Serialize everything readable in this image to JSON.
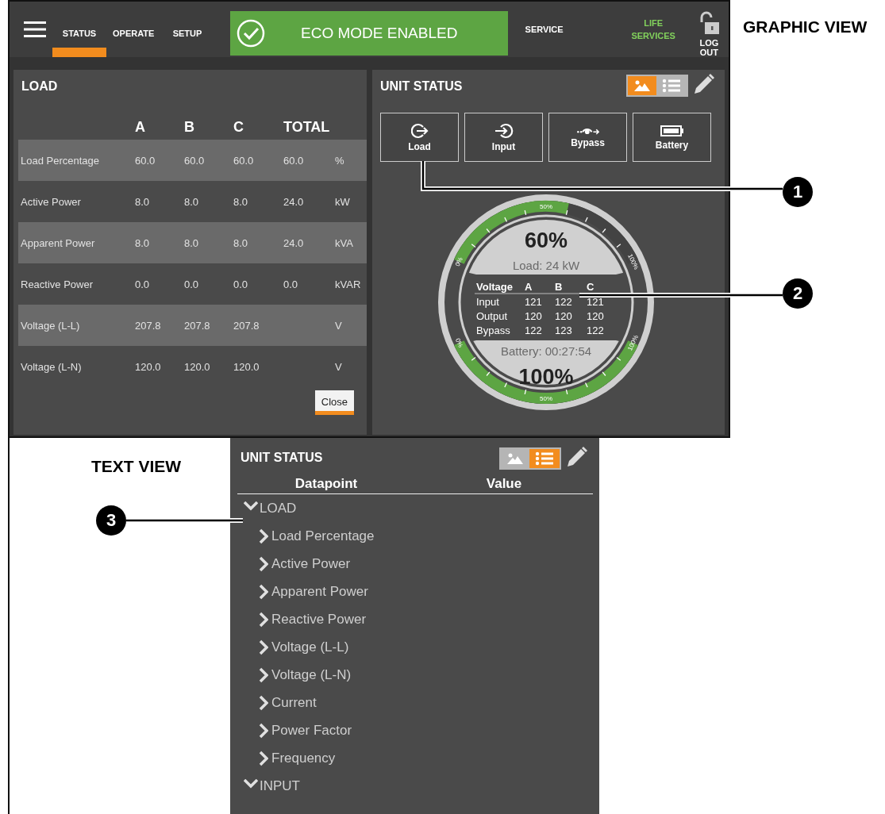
{
  "graphic_view": {
    "caption": "GRAPHIC VIEW",
    "nav": {
      "tabs": [
        {
          "label": "STATUS",
          "selected": true
        },
        {
          "label": "OPERATE",
          "selected": false
        },
        {
          "label": "SETUP",
          "selected": false
        }
      ],
      "banner": "ECO MODE ENABLED",
      "service": "SERVICE",
      "life_services": "LIFE SERVICES",
      "logout": "LOG OUT"
    },
    "load_panel": {
      "title": "LOAD",
      "columns": [
        "A",
        "B",
        "C",
        "TOTAL"
      ],
      "rows": [
        {
          "label": "Load Percentage",
          "values": [
            "60.0",
            "60.0",
            "60.0",
            "60.0"
          ],
          "unit": "%"
        },
        {
          "label": "Active Power",
          "values": [
            "8.0",
            "8.0",
            "8.0",
            "24.0"
          ],
          "unit": "kW"
        },
        {
          "label": "Apparent Power",
          "values": [
            "8.0",
            "8.0",
            "8.0",
            "24.0"
          ],
          "unit": "kVA"
        },
        {
          "label": "Reactive Power",
          "values": [
            "0.0",
            "0.0",
            "0.0",
            "0.0"
          ],
          "unit": "kVAR"
        },
        {
          "label": "Voltage (L-L)",
          "values": [
            "207.8",
            "207.8",
            "207.8"
          ],
          "unit": "V"
        },
        {
          "label": "Voltage (L-N)",
          "values": [
            "120.0",
            "120.0",
            "120.0"
          ],
          "unit": "V"
        }
      ],
      "close_button": "Close"
    },
    "unit_status": {
      "title": "UNIT STATUS",
      "view_toggle": [
        {
          "kind": "graphic",
          "selected": true
        },
        {
          "kind": "text",
          "selected": false
        }
      ],
      "buttons": [
        {
          "kind": "load",
          "label": "Load"
        },
        {
          "kind": "input",
          "label": "Input"
        },
        {
          "kind": "bypass",
          "label": "Bypass"
        },
        {
          "kind": "battery",
          "label": "Battery"
        }
      ],
      "gauge": {
        "load": {
          "level": 0.6,
          "value": "60%",
          "caption": "Load: 24 kW",
          "scale_labels": [
            "0%",
            "50%",
            "100%"
          ]
        },
        "battery": {
          "level": 1,
          "value": "100%",
          "caption": "Battery: 00:27:54",
          "scale_labels": [
            "0%",
            "50%",
            "100%"
          ]
        },
        "voltage": {
          "columns": [
            "Voltage",
            "A",
            "B",
            "C"
          ],
          "rows": [
            {
              "label": "Input",
              "values": [
                "121",
                "122",
                "121"
              ]
            },
            {
              "label": "Output",
              "values": [
                "120",
                "120",
                "120"
              ]
            },
            {
              "label": "Bypass",
              "values": [
                "122",
                "123",
                "122"
              ]
            }
          ]
        }
      }
    }
  },
  "text_view": {
    "caption": "TEXT VIEW",
    "unit_status": {
      "title": "UNIT STATUS",
      "view_toggle": [
        {
          "kind": "graphic",
          "selected": false
        },
        {
          "kind": "text",
          "selected": true
        }
      ],
      "columns": [
        "Datapoint",
        "Value"
      ],
      "tree": [
        {
          "label": "LOAD",
          "expanded": true,
          "children": [
            {
              "label": "Load Percentage",
              "expanded": false
            },
            {
              "label": "Active Power",
              "expanded": false
            },
            {
              "label": "Apparent Power",
              "expanded": false
            },
            {
              "label": "Reactive Power",
              "expanded": false
            },
            {
              "label": "Voltage (L-L)",
              "expanded": false
            },
            {
              "label": "Voltage (L-N)",
              "expanded": false
            },
            {
              "label": "Current",
              "expanded": false
            },
            {
              "label": "Power Factor",
              "expanded": false
            },
            {
              "label": "Frequency",
              "expanded": false
            }
          ]
        },
        {
          "label": "INPUT",
          "expanded": true
        }
      ]
    }
  },
  "callouts": [
    "1",
    "2",
    "3"
  ]
}
